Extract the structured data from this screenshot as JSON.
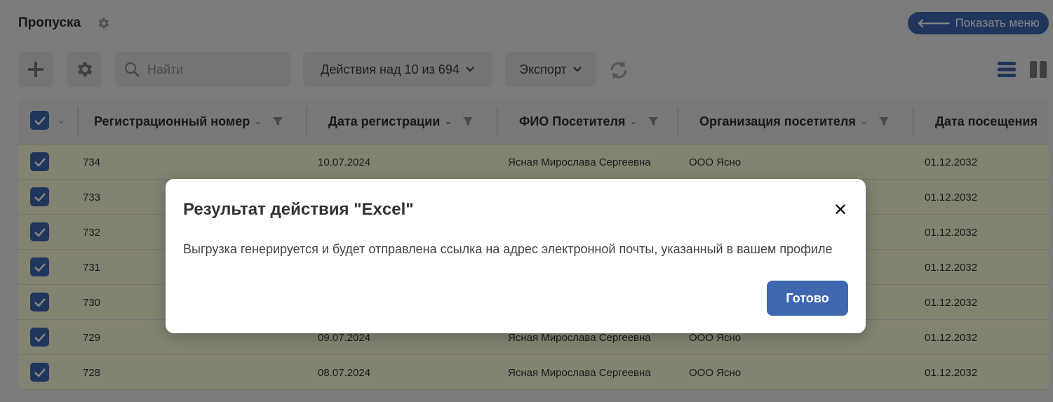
{
  "page": {
    "title": "Пропуска",
    "show_menu_label": "Показать меню",
    "show_menu_arrow": "🡐"
  },
  "toolbar": {
    "search_placeholder": "Найти",
    "actions_label": "Действия над 10 из 694",
    "export_label": "Экспорт"
  },
  "table": {
    "columns": [
      "Регистрационный номер",
      "Дата регистрации",
      "ФИО Посетителя",
      "Организация посетителя",
      "Дата посещения"
    ],
    "rows": [
      {
        "num": "734",
        "reg_date": "10.07.2024",
        "fio": "Ясная Мирослава Сергеевна",
        "org": "ООО Ясно",
        "visit": "01.12.2032"
      },
      {
        "num": "733",
        "reg_date": "",
        "fio": "",
        "org": "",
        "visit": "01.12.2032"
      },
      {
        "num": "732",
        "reg_date": "",
        "fio": "",
        "org": "",
        "visit": "01.12.2032"
      },
      {
        "num": "731",
        "reg_date": "",
        "fio": "",
        "org": "",
        "visit": "01.12.2032"
      },
      {
        "num": "730",
        "reg_date": "",
        "fio": "",
        "org": "",
        "visit": "01.12.2032"
      },
      {
        "num": "729",
        "reg_date": "09.07.2024",
        "fio": "Ясная Мирослава Сергеевна",
        "org": "ООО Ясно",
        "visit": "01.12.2032"
      },
      {
        "num": "728",
        "reg_date": "08.07.2024",
        "fio": "Ясная Мирослава Сергеевна",
        "org": "ООО Ясно",
        "visit": "01.12.2032"
      }
    ]
  },
  "modal": {
    "title": "Результат действия \"Excel\"",
    "close_symbol": "✕",
    "message": "Выгрузка генерируется и будет отправлена ссылка на адрес электронной почты, указанный в вашем профиле",
    "done_label": "Готово"
  },
  "colors": {
    "accent": "#3f67b0",
    "row_selected": "#fbfbd9",
    "overlay": "rgba(0,0,0,0.48)"
  },
  "icons": [
    "settings-gear-icon",
    "add-plus-icon",
    "search-icon",
    "chevron-down-icon",
    "refresh-icon",
    "list-view-icon",
    "columns-view-icon",
    "filter-funnel-icon",
    "checkbox-checked-icon",
    "close-icon",
    "arrow-left-icon"
  ]
}
